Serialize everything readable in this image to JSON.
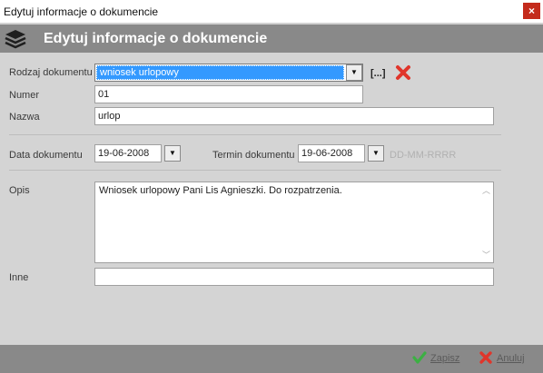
{
  "window": {
    "title": "Edytuj informacje o dokumencie",
    "close_symbol": "×"
  },
  "header": {
    "title": "Edytuj informacje o dokumencie",
    "icon": "layers-icon"
  },
  "form": {
    "rodzaj": {
      "label": "Rodzaj dokumentu",
      "value": "wniosek urlopowy",
      "browse_label": "[...]"
    },
    "numer": {
      "label": "Numer",
      "value": "01"
    },
    "nazwa": {
      "label": "Nazwa",
      "value": "urlop"
    },
    "data": {
      "label": "Data dokumentu",
      "value": "19-06-2008"
    },
    "termin": {
      "label": "Termin dokumentu",
      "value": "19-06-2008",
      "format_hint": "DD-MM-RRRR"
    },
    "opis": {
      "label": "Opis",
      "value": "Wniosek urlopowy Pani Lis Agnieszki. Do rozpatrzenia."
    },
    "inne": {
      "label": "Inne",
      "value": ""
    }
  },
  "footer": {
    "save_label": "Zapisz",
    "cancel_label": "Anuluj"
  },
  "colors": {
    "header_bg": "#898989",
    "selection_blue": "#3399ff",
    "delete_red": "#e0352b",
    "save_green": "#3cb043"
  }
}
